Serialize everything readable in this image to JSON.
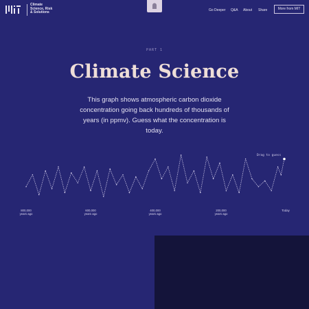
{
  "header": {
    "brand_text": "Climate\nScience, Risk\n& Solutions",
    "nav": [
      "Go Deeper",
      "Q&A",
      "About",
      "Share"
    ],
    "more_button": "More from MIT"
  },
  "eyebrow": "PART 1",
  "title": "Climate Science",
  "description": "This graph shows atmospheric carbon dioxide concentration going back hundreds of thousands of years (in ppmv). Guess what the concentration is today.",
  "chart": {
    "drag_hint": "Drag to guess",
    "ticks": [
      "800,000\nyears ago",
      "600,000\nyears ago",
      "400,000\nyears ago",
      "200,000\nyears ago",
      "Today"
    ]
  },
  "colors": {
    "background": "#262673",
    "title": "#eeded8",
    "panel": "#14143a",
    "home_button": "#ddd3e3"
  },
  "chart_data": {
    "type": "line",
    "title": "",
    "xlabel": "",
    "ylabel": "",
    "x": [
      -800000,
      -780000,
      -760000,
      -740000,
      -720000,
      -700000,
      -680000,
      -660000,
      -640000,
      -620000,
      -600000,
      -580000,
      -560000,
      -540000,
      -520000,
      -500000,
      -480000,
      -460000,
      -440000,
      -420000,
      -400000,
      -380000,
      -360000,
      -340000,
      -320000,
      -300000,
      -280000,
      -260000,
      -240000,
      -220000,
      -200000,
      -180000,
      -160000,
      -140000,
      -120000,
      -100000,
      -80000,
      -60000,
      -40000,
      -20000,
      -10000,
      0
    ],
    "values": [
      210,
      240,
      190,
      250,
      205,
      260,
      195,
      245,
      220,
      260,
      200,
      250,
      185,
      255,
      215,
      240,
      195,
      235,
      205,
      250,
      280,
      230,
      260,
      200,
      290,
      220,
      250,
      195,
      285,
      230,
      270,
      200,
      240,
      195,
      280,
      230,
      210,
      225,
      200,
      260,
      240,
      280
    ],
    "ylim": [
      170,
      300
    ]
  }
}
